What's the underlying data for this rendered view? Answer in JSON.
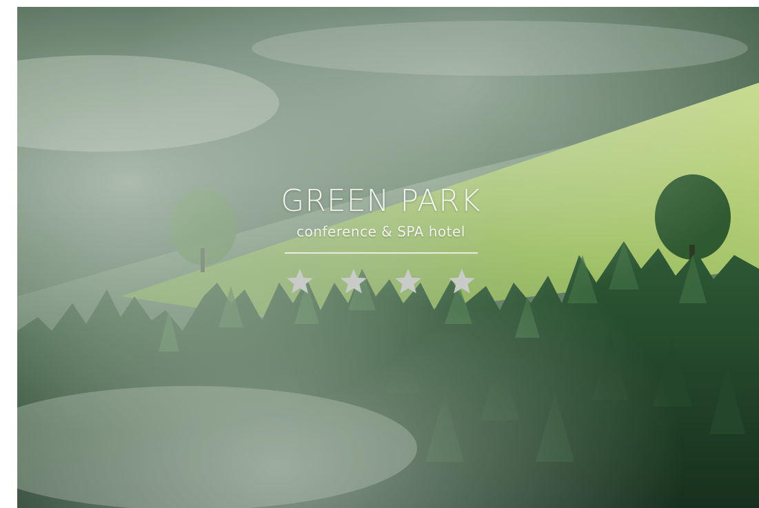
{
  "hotel": {
    "name": "GREEN PARK",
    "tagline": "conference & SPA hotel",
    "rating": 4,
    "rating_max": 4
  },
  "scene": {
    "description_icon": "forest-landscape",
    "colors": {
      "mist": "#cfd8cb",
      "meadow": "#9fbe5a",
      "forest_dark": "#1f3a26",
      "forest_mid": "#2f5a36",
      "sky_fog": "#7e9a84"
    }
  },
  "icons": {
    "star": "star-icon"
  }
}
